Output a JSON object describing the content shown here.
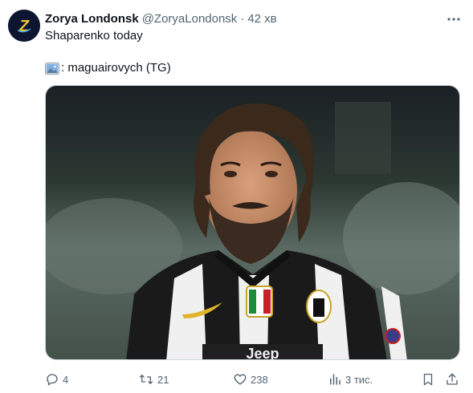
{
  "tweet": {
    "display_name": "Zorya Londonsk",
    "handle": "@ZoryaLondonsk",
    "separator": "·",
    "time_ago": "42 хв",
    "text_line1": "Shaparenko today",
    "text_line2": ": maguairovych (TG)",
    "avatar_letter": "Z"
  },
  "media": {
    "kit_text": "Jeep"
  },
  "actions": {
    "replies": "4",
    "retweets": "21",
    "likes": "238",
    "views": "3 тис."
  },
  "colors": {
    "text_primary": "#0f1419",
    "text_secondary": "#536471",
    "avatar_bg": "#0e1530",
    "avatar_accent": "#e9c43a"
  }
}
